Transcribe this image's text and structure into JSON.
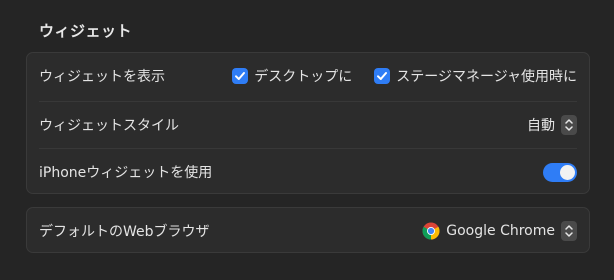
{
  "section": {
    "title": "ウィジェット"
  },
  "widgets": {
    "show_label": "ウィジェットを表示",
    "desktop_label": "デスクトップに",
    "stage_label": "ステージマネージャ使用時に",
    "style_label": "ウィジェットスタイル",
    "style_value": "自動",
    "iphone_label": "iPhoneウィジェットを使用",
    "iphone_enabled": true
  },
  "browser": {
    "label": "デフォルトのWebブラウザ",
    "value": "Google Chrome",
    "icon": "chrome-icon"
  },
  "colors": {
    "accent": "#2f7df6",
    "background": "#252525",
    "group": "#2c2c2c"
  }
}
